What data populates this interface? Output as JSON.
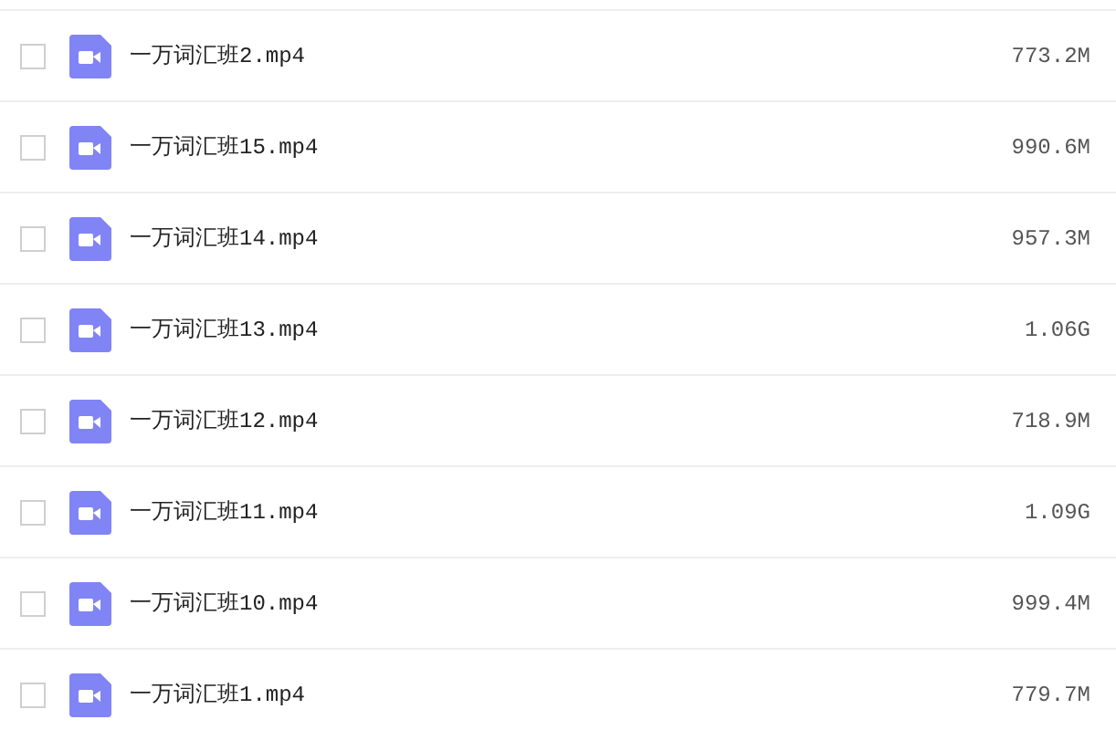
{
  "files": [
    {
      "name": "一万词汇班2.mp4",
      "size": "773.2M",
      "checked": false
    },
    {
      "name": "一万词汇班15.mp4",
      "size": "990.6M",
      "checked": false
    },
    {
      "name": "一万词汇班14.mp4",
      "size": "957.3M",
      "checked": false
    },
    {
      "name": "一万词汇班13.mp4",
      "size": "1.06G",
      "checked": false
    },
    {
      "name": "一万词汇班12.mp4",
      "size": "718.9M",
      "checked": false
    },
    {
      "name": "一万词汇班11.mp4",
      "size": "1.09G",
      "checked": false
    },
    {
      "name": "一万词汇班10.mp4",
      "size": "999.4M",
      "checked": false
    },
    {
      "name": "一万词汇班1.mp4",
      "size": "779.7M",
      "checked": false
    }
  ]
}
